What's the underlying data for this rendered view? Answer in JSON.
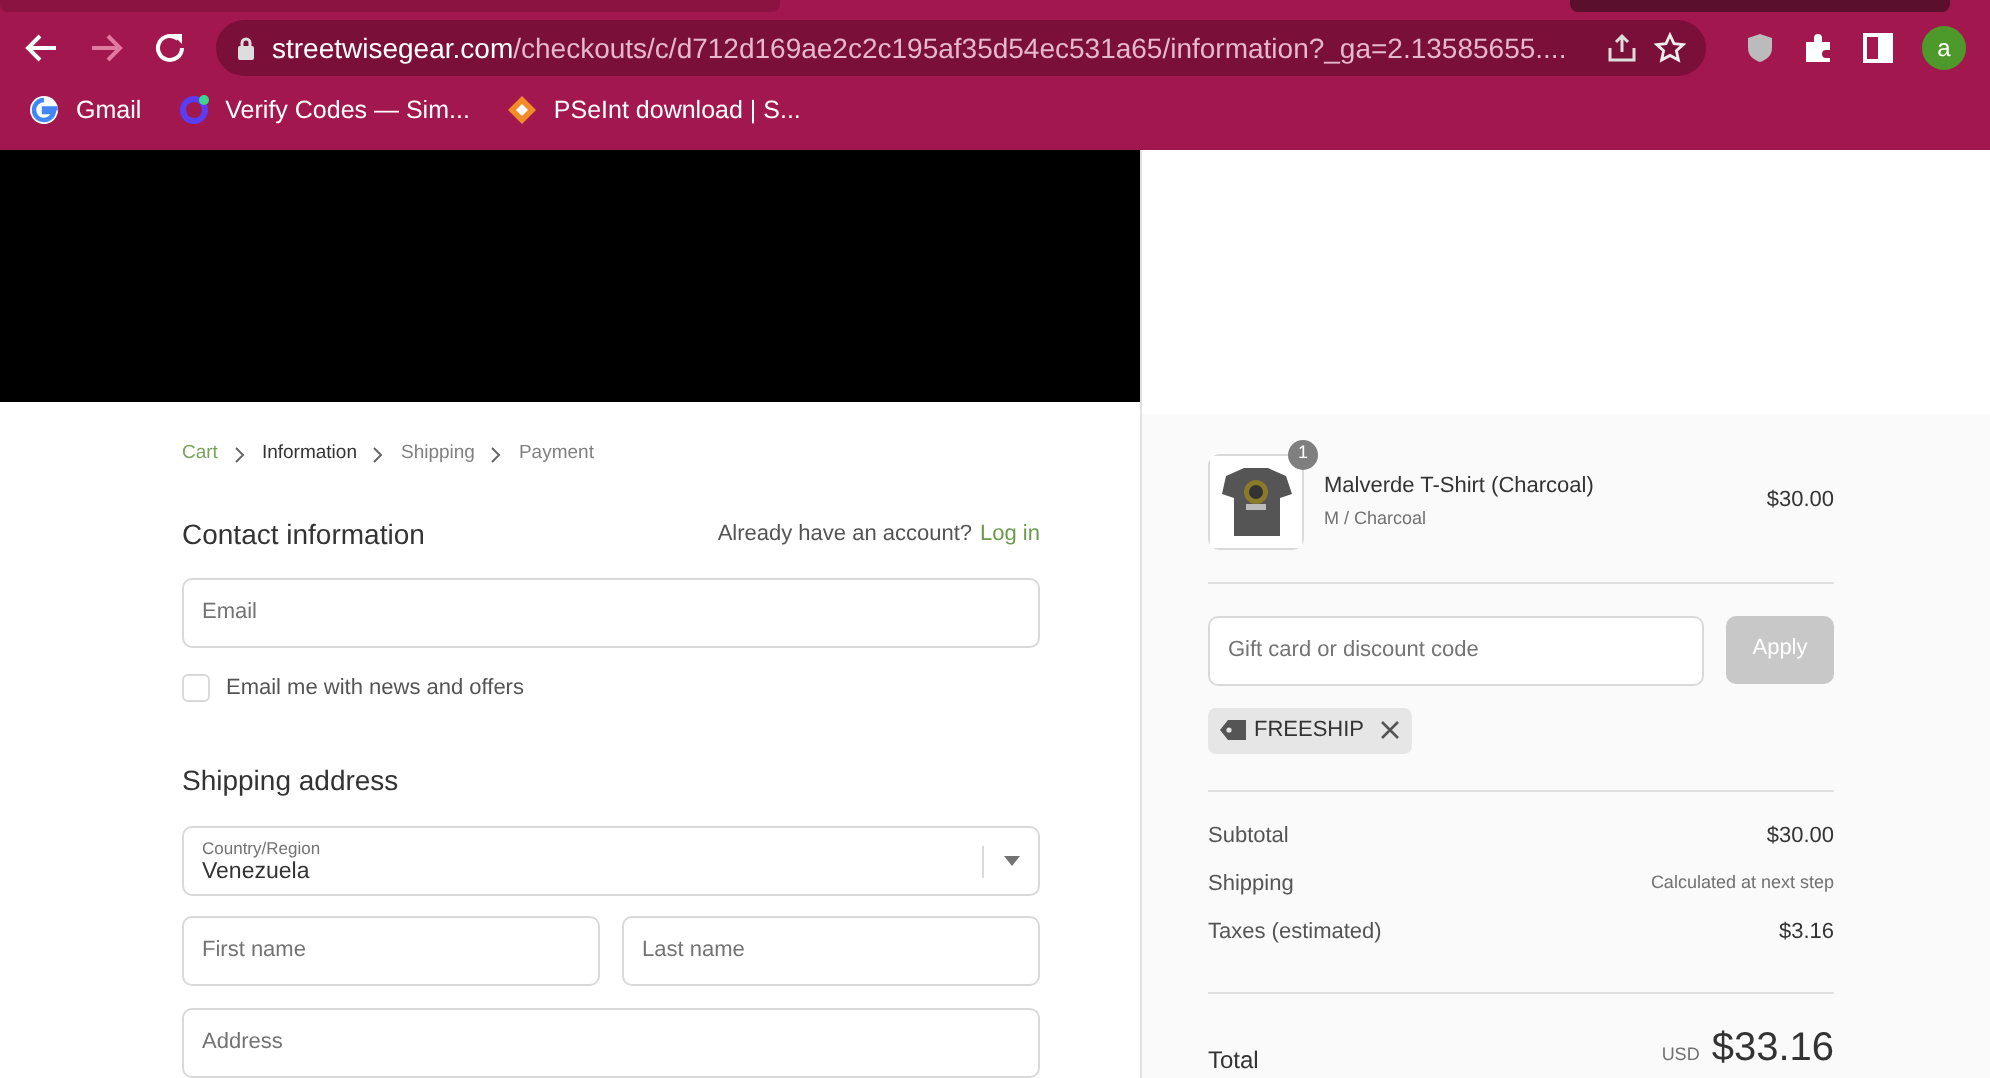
{
  "browser": {
    "url_domain": "streetwisegear.com",
    "url_path": "/checkouts/c/d712d169ae2c2c195af35d54ec531a65/information?_ga=2.13585655....",
    "profile_initial": "a",
    "bookmarks": [
      {
        "label": "Gmail",
        "kind": "google"
      },
      {
        "label": "Verify Codes — Sim...",
        "kind": "ring"
      },
      {
        "label": "PSeInt download | S...",
        "kind": "diamond"
      }
    ]
  },
  "breadcrumbs": [
    {
      "label": "Cart",
      "selected": false,
      "done": true
    },
    {
      "label": "Information",
      "selected": true,
      "done": false
    },
    {
      "label": "Shipping",
      "selected": false,
      "done": false
    },
    {
      "label": "Payment",
      "selected": false,
      "done": false
    }
  ],
  "contact": {
    "title": "Contact information",
    "account_prompt": "Already have an account?",
    "login_link": "Log in",
    "email_placeholder": "Email",
    "newsletter": {
      "label": "Email me with news and offers",
      "checked": false
    }
  },
  "shipping": {
    "title": "Shipping address",
    "country_label": "Country/Region",
    "country_value": "Venezuela",
    "first_name_placeholder": "First name",
    "last_name_placeholder": "Last name",
    "address_placeholder": "Address"
  },
  "summary": {
    "item": {
      "quantity": "1",
      "name": "Malverde T-Shirt (Charcoal)",
      "variant": "M / Charcoal",
      "price": "$30.00",
      "kind": "picture"
    },
    "discount_placeholder": "Gift card or discount code",
    "apply_button": "Apply",
    "apply_disabled": true,
    "applied_code": "FREESHIP",
    "lines": [
      {
        "label": "Subtotal",
        "value": "$30.00",
        "kind": "amount"
      },
      {
        "label": "Shipping",
        "value": "Calculated at next step",
        "kind": "note"
      },
      {
        "label": "Taxes (estimated)",
        "value": "$3.16",
        "kind": "amount"
      }
    ],
    "total": {
      "label": "Total",
      "currency": "USD",
      "value": "$33.16"
    }
  }
}
